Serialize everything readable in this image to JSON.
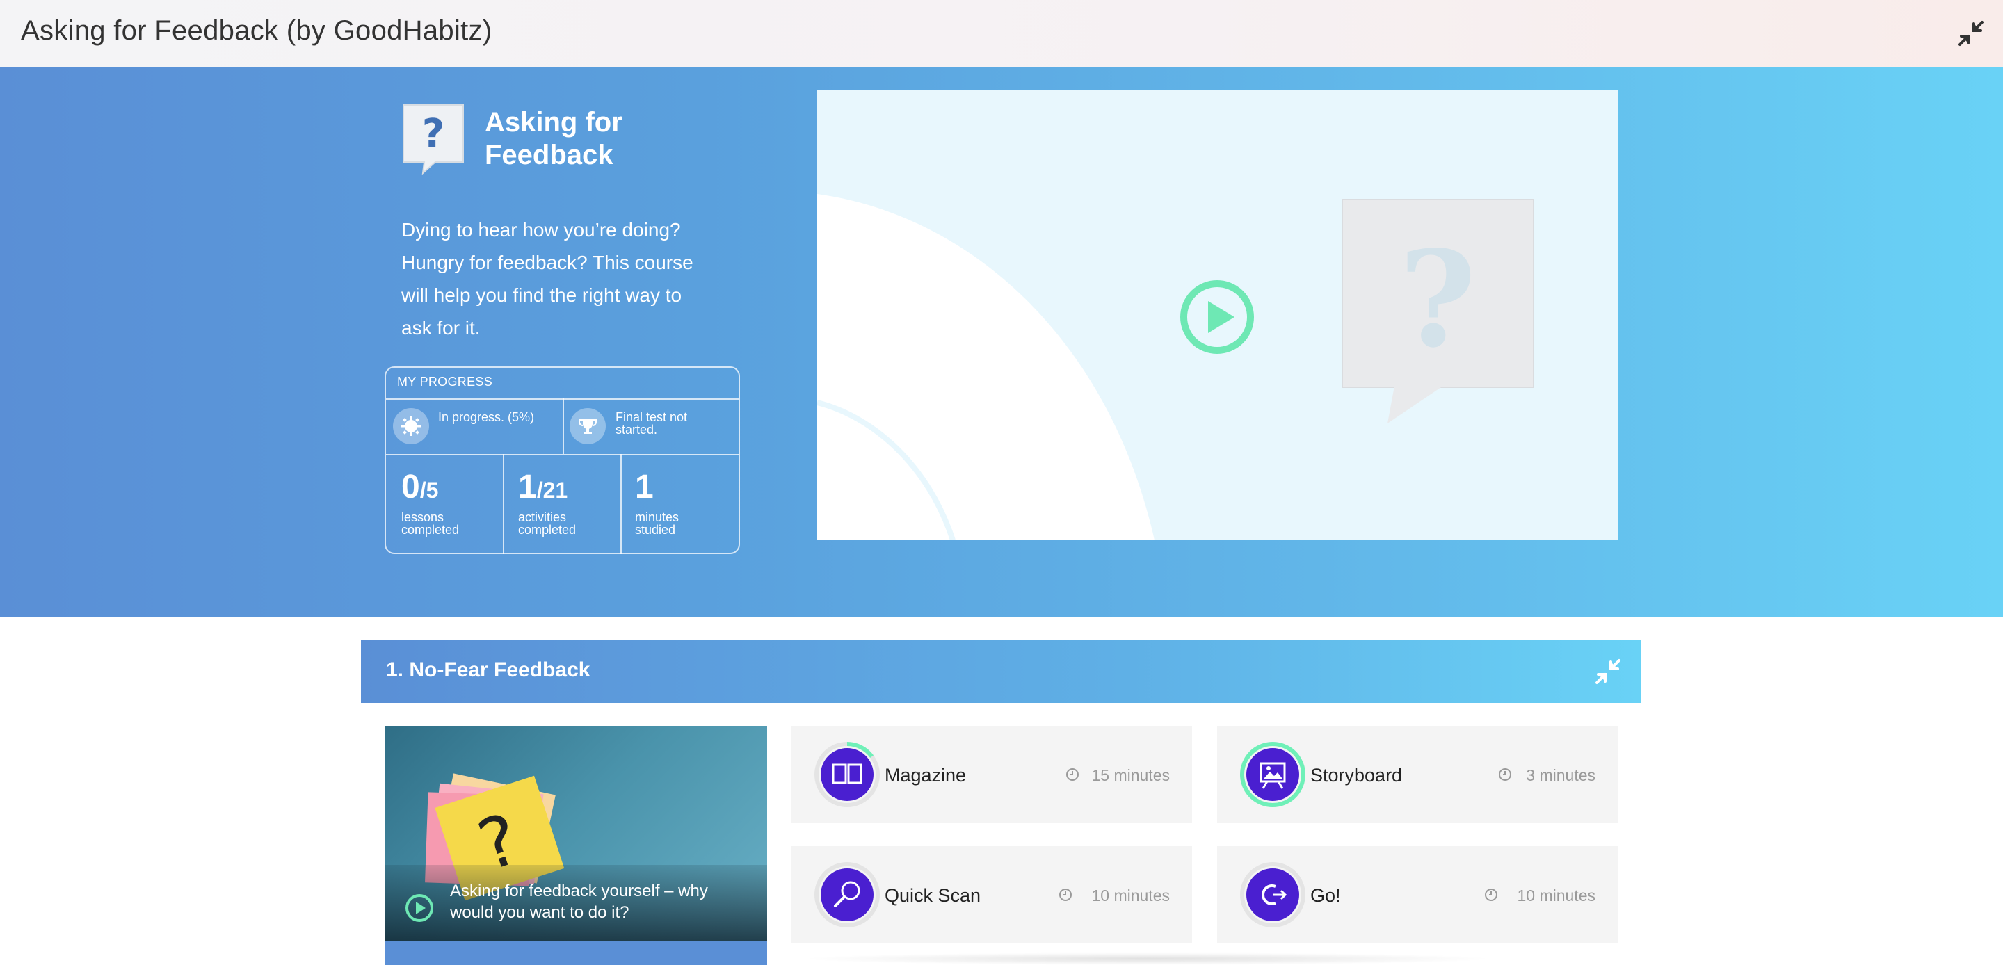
{
  "window": {
    "title": "Asking for Feedback (by GoodHabitz)"
  },
  "course": {
    "title": "Asking for Feedback",
    "description": "Dying to hear how you’re doing? Hungry for feedback? This course will help you find the right way to ask for it."
  },
  "progress": {
    "heading": "MY PROGRESS",
    "status": "In progress. (5%)",
    "status_percent": 5,
    "final_test": "Final test not started.",
    "lessons": {
      "done": "0",
      "total": "/5",
      "label": "lessons completed"
    },
    "activities": {
      "done": "1",
      "total": "/21",
      "label": "activities completed"
    },
    "minutes": {
      "value": "1",
      "label": "minutes studied"
    }
  },
  "module": {
    "title": "1. No-Fear Feedback"
  },
  "lesson": {
    "caption": "Asking for feedback yourself – why would you want to do it?"
  },
  "activities": [
    {
      "name": "Magazine",
      "duration": "15 minutes",
      "icon": "book-icon",
      "progress": 0.15
    },
    {
      "name": "Storyboard",
      "duration": "3 minutes",
      "icon": "storyboard-icon",
      "progress": 1.0
    },
    {
      "name": "Quick Scan",
      "duration": "10 minutes",
      "icon": "magnifier-icon",
      "progress": 0
    },
    {
      "name": "Go!",
      "duration": "10 minutes",
      "icon": "go-icon",
      "progress": 0
    }
  ],
  "colors": {
    "accent_purple": "#4a1fd0",
    "progress_green": "#6ff0b8",
    "play_green": "#6ee8b4"
  }
}
